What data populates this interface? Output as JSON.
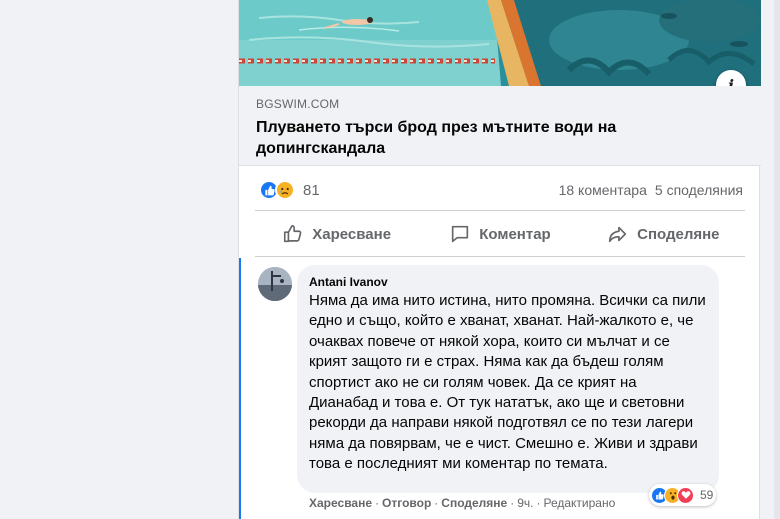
{
  "colors": {
    "accent": "#1877f2",
    "secondary_text": "#65676b",
    "bubble_bg": "#f0f2f5",
    "love": "#f33e58",
    "sad": "#f7b125"
  },
  "post": {
    "link": {
      "domain": "BGSWIM.COM",
      "title": "Плуването търси брод през мътните води на допингскандала",
      "info_icon": "info-icon"
    },
    "stats": {
      "reaction_icons": [
        "like-reaction-icon",
        "sad-reaction-icon"
      ],
      "reaction_count": "81",
      "comments": "18 коментара",
      "shares": "5 споделяния"
    },
    "actions": {
      "like_label": "Харесване",
      "comment_label": "Коментар",
      "share_label": "Споделяне"
    }
  },
  "comment": {
    "author": "Antani Ivanov",
    "text": "Няма да има нито истина, нито промяна. Всички са пили едно и също, който е хванат, хванат. Най-жалкото е, че очаквах повече от някой хора, които си мълчат и се крият защото ги е страх. Няма как да бъдеш голям спортист ако не си голям човек. Да се крият на Дианабад и това е. От тук нататък, ако ще и световни рекорди да направи някой подготвял се по тези лагери няма да повярвам, че е чист. Смешно е. Живи и здрави това е последният ми коментар по темата.",
    "footer": {
      "like": "Харесване",
      "reply": "Отговор",
      "share": "Споделяне",
      "time": "9ч.",
      "edited": "Редактирано"
    },
    "reactions": {
      "icons": [
        "like-reaction-icon",
        "wow-reaction-icon",
        "love-reaction-icon"
      ],
      "count": "59"
    }
  }
}
